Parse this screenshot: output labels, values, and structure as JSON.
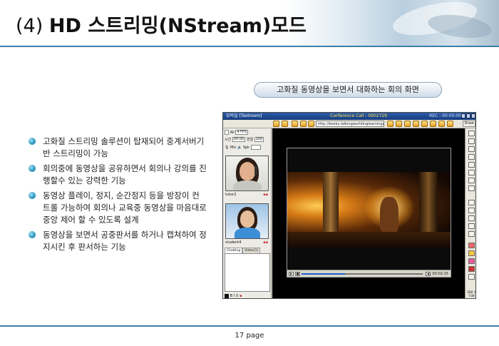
{
  "slide": {
    "title_number": "(4)",
    "title_main": "HD 스트리밍(NStream)모드",
    "caption": "고화질 동영상을 보면서 대화하는 회의 화면",
    "bullets": [
      "고화질 스트리밍 솔루션이 탑재되어 중계서버기반 스트리밍이 가능",
      "회의중에 동영상을 공유하면서 회의나 강의를 진행할수 있는 강력한 기능",
      "동영상 플레이, 정지, 순간정지 등을 방장이 컨트롤 가능하여 회의나 교육중 동영상을 마음대로 중앙 제어 할 수 있도록 설계",
      "동영상을 보면서 공중판서를 하거나 캡쳐하여 정지시킨 후 판서하는 기능"
    ],
    "page_label": "17 page",
    "accent_color": "#3d7fa7"
  },
  "app": {
    "title_left": "강의실 [Testroom]",
    "title_center": "Conference Call : 0902729",
    "title_right": "REC : 00:00:00",
    "url": "http://books.talkingworldinglearningworld.com/",
    "draw_label": "Draw",
    "zoom_label": "300 X Y38",
    "left_panel": {
      "row1_label": "All",
      "row1_value": "4 FPS",
      "time_label": "시간",
      "time_value": "00:00",
      "count_label": "연결",
      "count_value": "100",
      "mic_label": "Mic",
      "spk_label": "Spk",
      "user1": "tutor2",
      "user2": "student4",
      "tabs": [
        "Chatting",
        "Video(1)",
        "Voice(0)"
      ],
      "chat_font_tools": "B I U"
    },
    "player": {
      "time": "00:02:15",
      "progress": 0.36
    }
  }
}
